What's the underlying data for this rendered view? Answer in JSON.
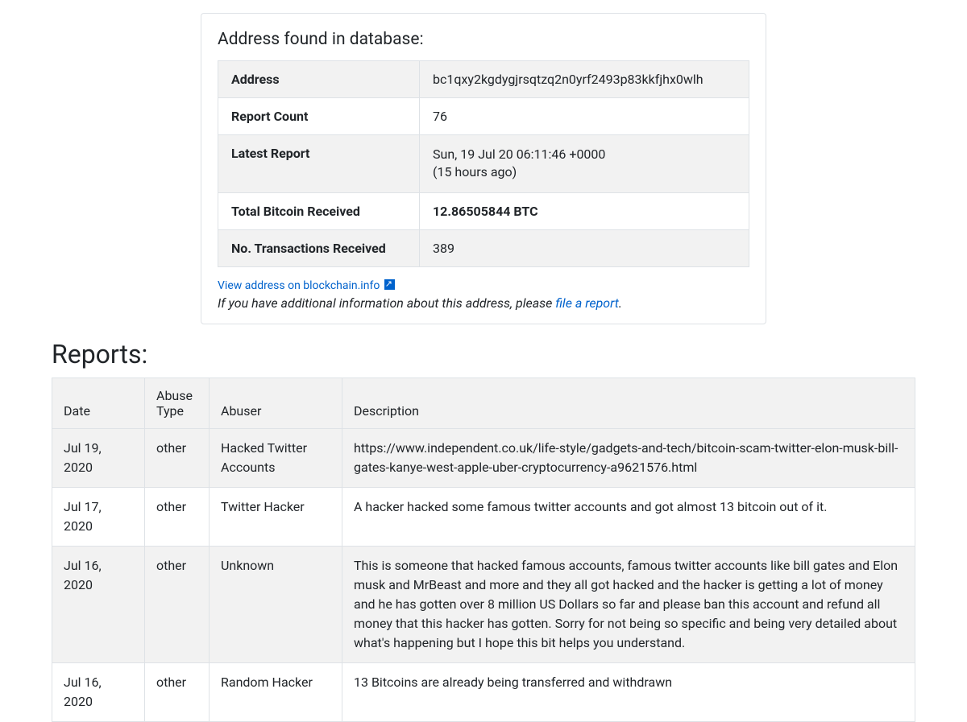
{
  "card": {
    "title": "Address found in database:",
    "rows": [
      {
        "label": "Address",
        "value": "bc1qxy2kgdygjrsqtzq2n0yrf2493p83kkfjhx0wlh",
        "bold": false
      },
      {
        "label": "Report Count",
        "value": "76",
        "bold": false
      },
      {
        "label": "Latest Report",
        "value_line1": "Sun, 19 Jul 20 06:11:46 +0000",
        "value_line2": "(15 hours ago)",
        "multiline": true,
        "bold": false
      },
      {
        "label": "Total Bitcoin Received",
        "value": "12.86505844 BTC",
        "bold": true
      },
      {
        "label": "No. Transactions Received",
        "value": "389",
        "bold": false
      }
    ],
    "ext_link_text": "View address on blockchain.info",
    "subtext_prefix": "If you have additional information about this address, please ",
    "subtext_link": "file a report",
    "subtext_suffix": "."
  },
  "reports_heading": "Reports:",
  "reports": {
    "headers": [
      "Date",
      "Abuse Type",
      "Abuser",
      "Description"
    ],
    "rows": [
      {
        "date": "Jul 19, 2020",
        "type": "other",
        "abuser": "Hacked Twitter Accounts",
        "description": "https://www.independent.co.uk/life-style/gadgets-and-tech/bitcoin-scam-twitter-elon-musk-bill-gates-kanye-west-apple-uber-cryptocurrency-a9621576.html"
      },
      {
        "date": "Jul 17, 2020",
        "type": "other",
        "abuser": "Twitter Hacker",
        "description": "A hacker hacked some famous twitter accounts and got almost 13 bitcoin out of it."
      },
      {
        "date": "Jul 16, 2020",
        "type": "other",
        "abuser": "Unknown",
        "description": "This is someone that hacked famous accounts, famous twitter accounts like bill gates and Elon musk and MrBeast and more and they all got hacked and the hacker is getting a lot of money and he has gotten over 8 million US Dollars so far and please ban this account and refund all money that this hacker has gotten. Sorry for not being so specific and being very detailed about what's happening but I hope this bit helps you understand."
      },
      {
        "date": "Jul 16, 2020",
        "type": "other",
        "abuser": "Random Hacker",
        "description": "13 Bitcoins are already being transferred and withdrawn"
      }
    ]
  }
}
